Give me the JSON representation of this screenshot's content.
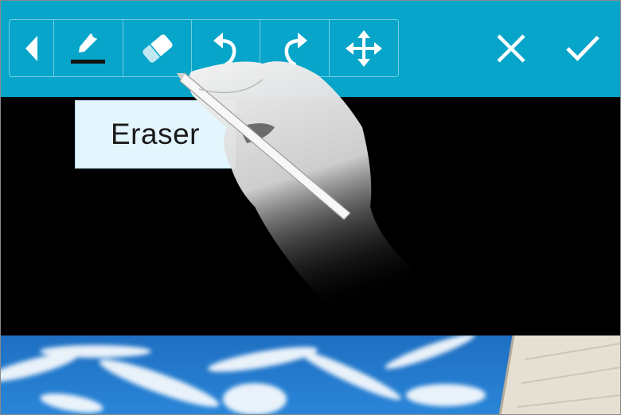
{
  "toolbar": {
    "tools": [
      {
        "name": "back",
        "icon": "chevron-left-icon"
      },
      {
        "name": "pen",
        "icon": "pen-icon"
      },
      {
        "name": "eraser",
        "icon": "eraser-icon"
      },
      {
        "name": "undo",
        "icon": "undo-icon"
      },
      {
        "name": "redo",
        "icon": "redo-icon"
      },
      {
        "name": "move",
        "icon": "move-icon"
      }
    ],
    "actions": [
      {
        "name": "cancel",
        "icon": "close-icon"
      },
      {
        "name": "confirm",
        "icon": "check-icon"
      }
    ],
    "accent_color": "#06a5c9"
  },
  "tooltip": {
    "text": "Eraser"
  }
}
